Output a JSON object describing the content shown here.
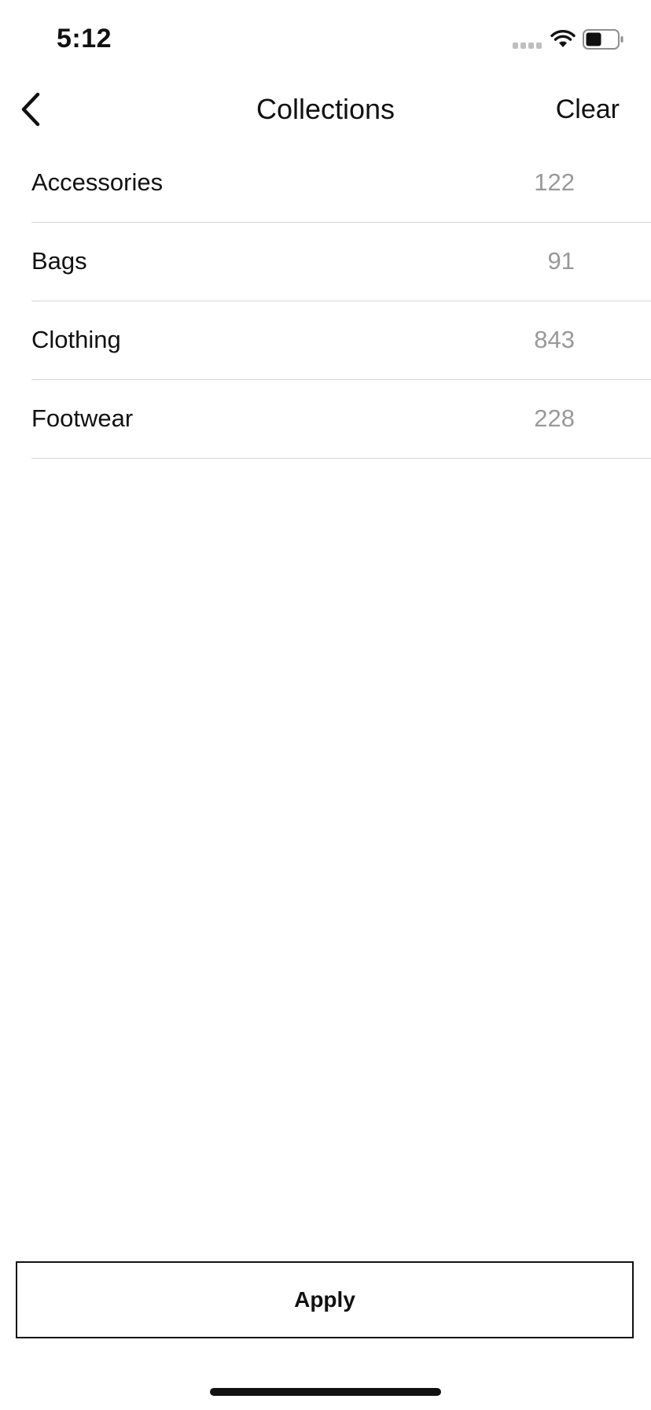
{
  "status_bar": {
    "time": "5:12",
    "icons": [
      "cellular-signal-icon",
      "wifi-icon",
      "battery-icon"
    ]
  },
  "nav": {
    "back_icon": "chevron-left-icon",
    "title": "Collections",
    "clear_label": "Clear"
  },
  "collections": {
    "items": [
      {
        "label": "Accessories",
        "count": "122"
      },
      {
        "label": "Bags",
        "count": "91"
      },
      {
        "label": "Clothing",
        "count": "843"
      },
      {
        "label": "Footwear",
        "count": "228"
      }
    ]
  },
  "footer": {
    "apply_label": "Apply"
  },
  "colors": {
    "text": "#111111",
    "count_text": "#999999",
    "divider": "#d6d6d6",
    "background": "#ffffff"
  }
}
